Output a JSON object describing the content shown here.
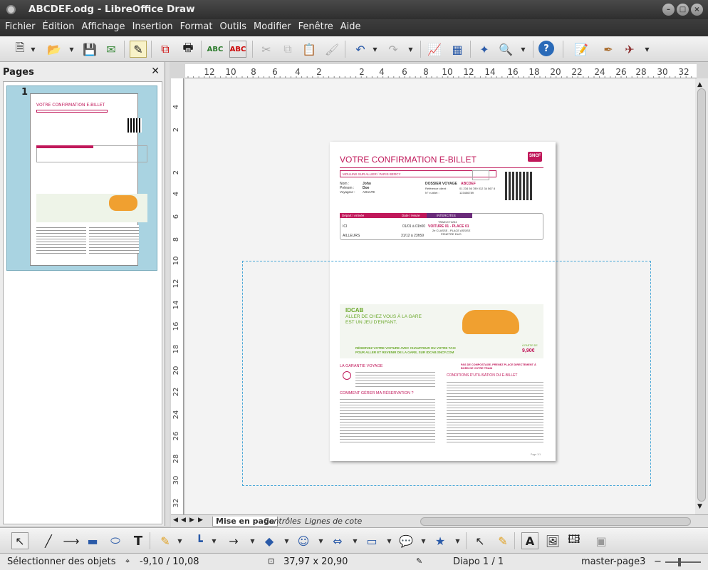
{
  "window": {
    "title": "ABCDEF.odg - LibreOffice Draw"
  },
  "menu": [
    "Fichier",
    "Édition",
    "Affichage",
    "Insertion",
    "Format",
    "Outils",
    "Modifier",
    "Fenêtre",
    "Aide"
  ],
  "sidebar": {
    "title": "Pages",
    "page_number": "1"
  },
  "ruler": {
    "h_ticks": [
      "12",
      "10",
      "8",
      "6",
      "4",
      "2",
      "2",
      "4",
      "6",
      "8",
      "10",
      "12",
      "14",
      "16",
      "18",
      "20",
      "22",
      "24",
      "26",
      "28",
      "30",
      "32"
    ],
    "v_ticks": [
      "4",
      "2",
      "2",
      "4",
      "6",
      "8",
      "10",
      "12",
      "14",
      "16",
      "18",
      "20",
      "22",
      "24",
      "26",
      "28",
      "30",
      "32"
    ]
  },
  "tabs": [
    "Mise en page",
    "Contrôles",
    "Lignes de cote"
  ],
  "status": {
    "mode": "Sélectionner des objets",
    "position": "-9,10 / 10,08",
    "size": "37,97 x 20,90",
    "slide": "Diapo 1 / 1",
    "master": "master-page3"
  },
  "doc": {
    "heading": "VOTRE CONFIRMATION E-BILLET",
    "brand": "SNCF",
    "route": "MOULINS SUR ALLIER / PARIS BERCY",
    "name_label": "Nom :",
    "name": "Joho",
    "first_label": "Prénom :",
    "first": "Doe",
    "voy_label": "Voyageur :",
    "voy": "ADULTE",
    "dossier_label": "DOSSIER VOYAGE",
    "dossier": "ABCDEF",
    "client_label": "Référence client :",
    "client": "01 234 56 789 012 34 567 8",
    "billet_label": "N° e-billet :",
    "billet": "123456789",
    "col_depart": "Départ / Arrivée",
    "col_date": "Date / Heure",
    "col_inter": "INTERCITES",
    "row1_city": "ICI",
    "row1_date": "01/01 à 01h00",
    "row2_city": "AILLEURS",
    "row2_date": "31/12 à 23h59",
    "train": "TRAIN N°1234",
    "voiture": "VOITURE 01 - PLACE 01",
    "classe": "2e CLASSE - PLACE ASSISE",
    "fenetre": "FENETRE DUO",
    "ad_title": "IDCAB",
    "ad_line1": "ALLER DE CHEZ VOUS À LA GARE",
    "ad_line2": "EST UN JEU D'ENFANT.",
    "ad_cta1": "RÉSERVEZ VOTRE VOITURE AVEC CHAUFFEUR OU VOTRE TAXI",
    "ad_cta2": "POUR ALLER ET REVENIR DE LA GARE, SUR IDCAB.SNCF.COM",
    "ad_price_label": "À PARTIR DE",
    "ad_price": "9,90€",
    "garantie": "LA GARANTIE VOYAGE",
    "gerer": "COMMENT GÉRER MA RÉSERVATION ?",
    "conditions": "CONDITIONS D'UTILISATION DU E-BILLET",
    "compostage": "PAS DE COMPOSTAGE, PRENEZ PLACE DIRECTEMENT À BORD DE VOTRE TRAIN",
    "footer": "Page 1/1"
  },
  "colors": {
    "accent": "#c0185a",
    "inter": "#6a2b7a",
    "selection": "#4aa8d8"
  }
}
